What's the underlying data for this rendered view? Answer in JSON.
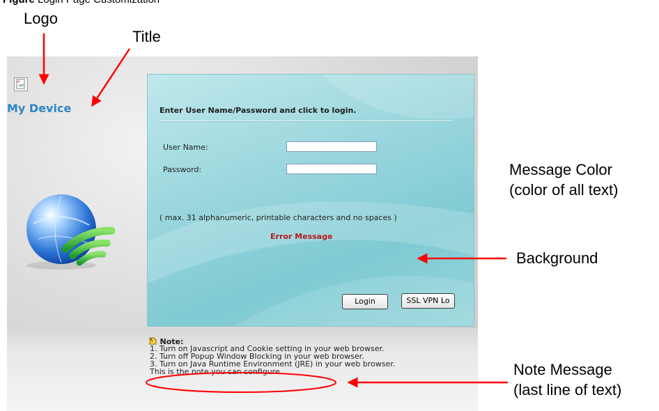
{
  "caption": {
    "prefix": "Figure",
    "text": "Login Page Customization"
  },
  "callouts": {
    "logo": "Logo",
    "title": "Title",
    "message_color_line1": "Message Color",
    "message_color_line2": "(color of  all text)",
    "background": "Background",
    "note_message_line1": "Note Message",
    "note_message_line2": "(last line of text)"
  },
  "device": {
    "logo_icon": "broken-image-icon",
    "title": "My Device",
    "title_color": "#2e84c5"
  },
  "login": {
    "heading": "Enter User Name/Password and click to login.",
    "username_label": "User Name:",
    "username_value": "",
    "password_label": "Password:",
    "password_value": "",
    "hint": "( max. 31 alphanumeric, printable characters and no spaces )",
    "error": "Error Message",
    "error_color": "#b51b1b",
    "login_button": "Login",
    "ssl_button": "SSL VPN Lo"
  },
  "note": {
    "title": "Note:",
    "icon": "note-icon",
    "lines": [
      "1. Turn on Javascript and Cookie setting in your web browser.",
      "2. Turn off Popup Window Blocking in your web browser.",
      "3. Turn on Java Runtime Environment (JRE) in your web browser.",
      "This is the note you can configure."
    ]
  },
  "colors": {
    "annotation_arrow": "#ff0000",
    "panel_background": "#9ad6dd",
    "message_text": "#1f1f1f"
  }
}
